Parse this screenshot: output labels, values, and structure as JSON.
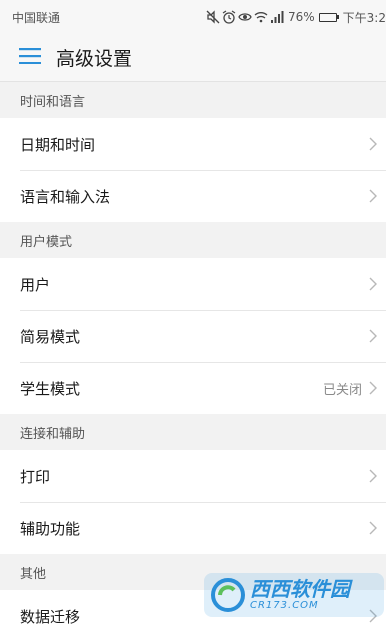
{
  "status_bar": {
    "carrier": "中国联通",
    "battery_percent": "76%",
    "battery_level": 0.76,
    "time": "下午3:2"
  },
  "header": {
    "title": "高级设置"
  },
  "sections": [
    {
      "title": "时间和语言",
      "items": [
        {
          "label": "日期和时间",
          "value": ""
        },
        {
          "label": "语言和输入法",
          "value": ""
        }
      ]
    },
    {
      "title": "用户模式",
      "items": [
        {
          "label": "用户",
          "value": ""
        },
        {
          "label": "简易模式",
          "value": ""
        },
        {
          "label": "学生模式",
          "value": "已关闭"
        }
      ]
    },
    {
      "title": "连接和辅助",
      "items": [
        {
          "label": "打印",
          "value": ""
        },
        {
          "label": "辅助功能",
          "value": ""
        }
      ]
    },
    {
      "title": "其他",
      "items": [
        {
          "label": "数据迁移",
          "value": ""
        }
      ]
    }
  ],
  "watermark": {
    "main": "西西软件园",
    "sub": "CR173.COM"
  },
  "colors": {
    "accent": "#2a8fd8",
    "section_bg": "#f2f2f2",
    "divider": "#e6e6e6"
  },
  "icons": {
    "menu": "hamburger-icon",
    "chevron": "chevron-right-icon",
    "mute": "mute-icon",
    "alarm": "alarm-icon",
    "eye": "eye-comfort-icon",
    "wifi": "wifi-icon",
    "signal": "signal-icon",
    "battery": "battery-icon"
  }
}
